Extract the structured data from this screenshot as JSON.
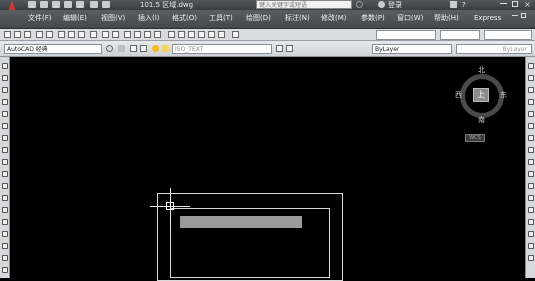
{
  "title_bar": {
    "file_title": "101.5 区域.dwg",
    "search_placeholder": "键入关键字或短语",
    "login_label": "登录",
    "help_label": "?"
  },
  "menu": {
    "items": [
      "文件(F)",
      "编辑(E)",
      "视图(V)",
      "插入(I)",
      "格式(O)",
      "工具(T)",
      "绘图(D)",
      "标注(N)",
      "修改(M)",
      "参数(P)",
      "窗口(W)",
      "帮助(H)",
      "Express"
    ]
  },
  "toolbar": {
    "workspace": "AutoCAD 经典",
    "layer_value": "ByLayer",
    "layer_value2": "ByLayer",
    "current_layer": "ISO_TEXT"
  },
  "viewcube": {
    "north": "北",
    "south": "南",
    "east": "东",
    "west": "西",
    "top": "上",
    "wcs": "WCS"
  },
  "colors": {
    "canvas_bg": "#000000",
    "ui_dark": "#45484b",
    "ui_light": "#d9dbde",
    "logo_red": "#c02828",
    "rect_stroke": "#d8d8d8",
    "filled_bar": "#9b9b9b"
  }
}
